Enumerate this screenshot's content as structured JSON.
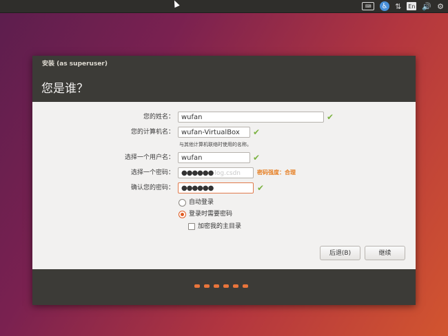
{
  "topbar": {
    "keyboard_icon": "keyboard-icon",
    "accessibility_icon": "accessibility-icon",
    "network_icon": "network-icon",
    "language": "En",
    "volume_icon": "volume-icon",
    "settings_icon": "gear-icon"
  },
  "window": {
    "title": "安装 (as superuser)",
    "heading": "您是谁？"
  },
  "form": {
    "name_label": "您的姓名：",
    "name_value": "wufan",
    "computer_label": "您的计算机名：",
    "computer_value": "wufan-VirtualBox",
    "computer_hint": "与其他计算机联络时使用的名称。",
    "username_label": "选择一个用户名：",
    "username_value": "wufan",
    "password_label": "选择一个密码：",
    "password_value": "●●●●●●",
    "password_watermark": "log.csdn",
    "password_strength": "密码强度：合理",
    "confirm_label": "确认您的密码：",
    "confirm_value": "●●●●●●"
  },
  "options": {
    "auto_login": "自动登录",
    "require_password": "登录时需要密码",
    "encrypt_home": "加密我的主目录"
  },
  "buttons": {
    "back": "后退(B)",
    "continue": "继续"
  },
  "progress": {
    "total_steps": 6
  }
}
